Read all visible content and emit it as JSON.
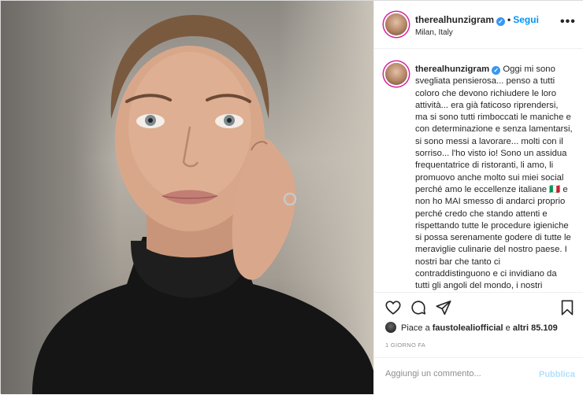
{
  "post": {
    "username": "therealhunzigram",
    "verified_icon": "verified-badge-icon",
    "dot": "•",
    "follow_label": "Segui",
    "location": "Milan, Italy",
    "more_label": "•••",
    "caption": "Oggi mi sono svegliata pensierosa... penso a tutti coloro che devono richiudere le loro attività... era già faticoso riprendersi, ma si sono tutti rimboccati le maniche e con determinazione e senza lamentarsi, si sono messi a lavorare... molti con il sorriso... l'ho visto io! Sono un assidua frequentatrice di ristoranti, li amo, li promuovo anche molto sui miei social perché amo le eccellenze italiane 🇮🇹 e non ho MAI smesso di andarci proprio perché credo che stando attenti e rispettando tutte le procedure igieniche si possa serenamente godere di tutte le meraviglie culinarie del nostro paese. I nostri bar che tanto ci contraddistinguono e ci invidiano da tutti gli angoli del mondo, i nostri ristoranti..."
  },
  "actions": {
    "like_icon": "heart-icon",
    "comment_icon": "comment-icon",
    "share_icon": "share-icon",
    "save_icon": "bookmark-icon"
  },
  "likes": {
    "prefix": "Piace a ",
    "user": "faustolealiofficial",
    "middle": " e ",
    "others": "altri 85.109"
  },
  "timestamp": "1 GIORNO FA",
  "comment": {
    "placeholder": "Aggiungi un commento...",
    "publish_label": "Pubblica"
  },
  "colors": {
    "accent": "#0095f6",
    "verified": "#3897f0",
    "muted": "#8e8e8e",
    "publish_disabled": "#b2dffc"
  }
}
